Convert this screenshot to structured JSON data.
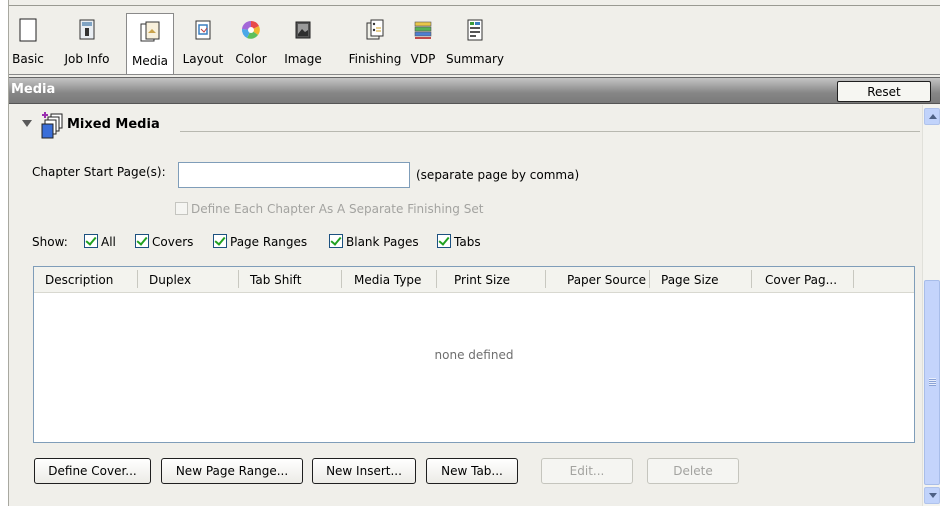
{
  "toolbar": {
    "tabs": [
      {
        "label": "Basic",
        "icon": "basic-page-icon"
      },
      {
        "label": "Job Info",
        "icon": "job-info-icon"
      },
      {
        "label": "Media",
        "icon": "media-icon",
        "active": true
      },
      {
        "label": "Layout",
        "icon": "layout-icon"
      },
      {
        "label": "Color",
        "icon": "color-wheel-icon"
      },
      {
        "label": "Image",
        "icon": "image-icon"
      },
      {
        "label": "Finishing",
        "icon": "finishing-icon"
      },
      {
        "label": "VDP",
        "icon": "vdp-icon"
      },
      {
        "label": "Summary",
        "icon": "summary-icon"
      }
    ]
  },
  "header": {
    "title": "Media",
    "reset_label": "Reset"
  },
  "section": {
    "title": "Mixed Media",
    "icon": "mixed-media-icon"
  },
  "chapter": {
    "label": "Chapter Start Page(s):",
    "value": "",
    "placeholder": "",
    "hint": "(separate page by comma)",
    "finishing_set_label": "Define Each Chapter As A Separate Finishing Set",
    "finishing_set_checked": false,
    "finishing_set_enabled": false
  },
  "show": {
    "label": "Show:",
    "options": [
      {
        "label": "All",
        "checked": true
      },
      {
        "label": "Covers",
        "checked": true
      },
      {
        "label": "Page Ranges",
        "checked": true
      },
      {
        "label": "Blank Pages",
        "checked": true
      },
      {
        "label": "Tabs",
        "checked": true
      }
    ]
  },
  "table": {
    "columns": [
      "Description",
      "Duplex",
      "Tab Shift",
      "Media Type",
      "Print Size",
      "Paper Source",
      "Page Size",
      "Cover Pag..."
    ],
    "rows": [],
    "empty_message": "none defined"
  },
  "buttons": {
    "define_cover": "Define Cover...",
    "new_page_range": "New Page Range...",
    "new_insert": "New Insert...",
    "new_tab": "New Tab...",
    "edit": "Edit...",
    "delete": "Delete"
  },
  "colors": {
    "header_gradient_top": "#c5c5c5",
    "header_gradient_bottom": "#7a7a7a",
    "panel_bg": "#f0efea",
    "checkbox_check": "#21a121",
    "scrollbar": "#c4d4fb"
  }
}
